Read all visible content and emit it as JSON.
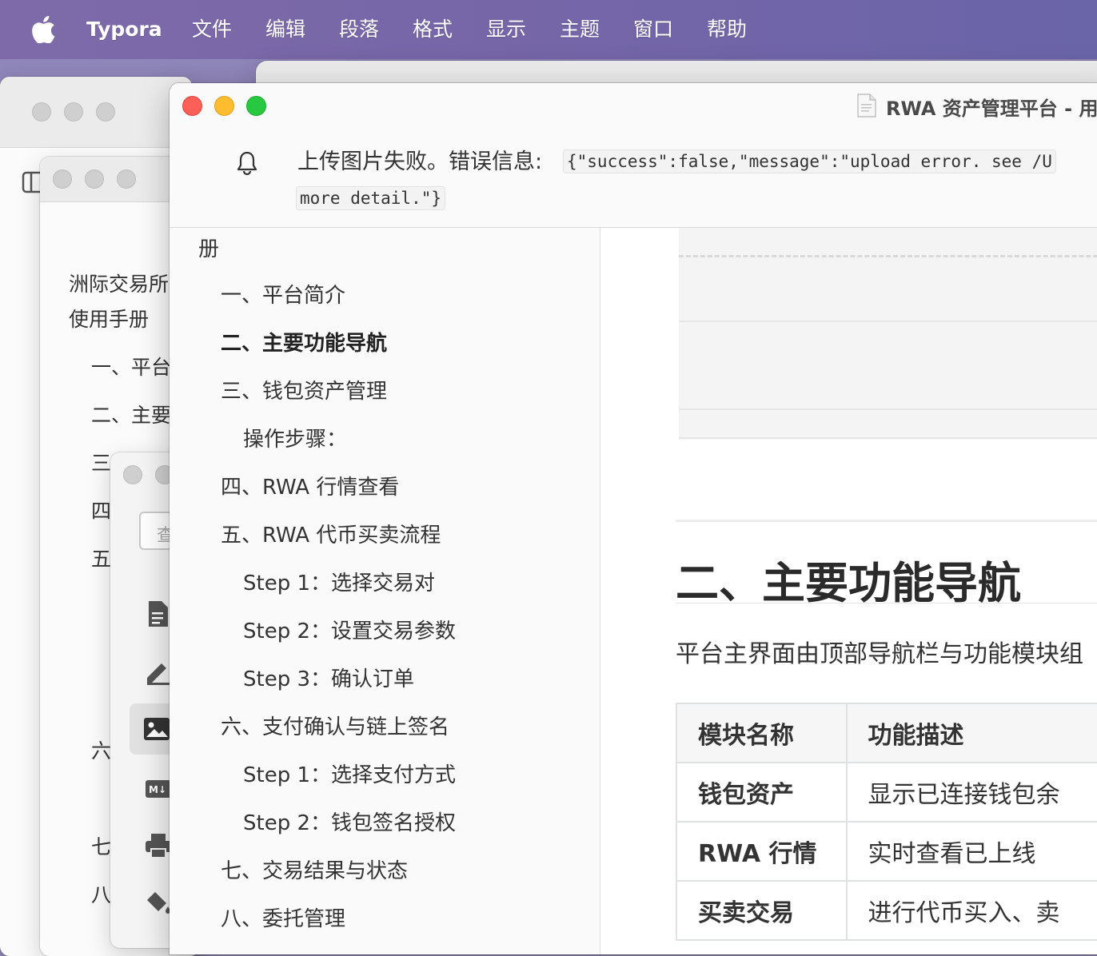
{
  "menubar": {
    "app": "Typora",
    "items": [
      "文件",
      "编辑",
      "段落",
      "格式",
      "显示",
      "主题",
      "窗口",
      "帮助"
    ]
  },
  "background_window": {
    "outline": [
      "洲际交易所",
      "使用手册",
      "一、平台",
      "二、主要",
      "三、",
      "四",
      "五",
      "六",
      "七",
      "八"
    ],
    "search_placeholder": "查"
  },
  "window": {
    "title": "RWA 资产管理平台 - 用",
    "notice_text": "上传图片失败。错误信息:",
    "notice_code_line1": "{\"success\":false,\"message\":\"upload error. see /U",
    "notice_code_line2": "more detail.\"}"
  },
  "outline": {
    "top_fragment": "册",
    "items": [
      {
        "label": "一、平台简介",
        "level": 1,
        "active": false
      },
      {
        "label": "二、主要功能导航",
        "level": 1,
        "active": true
      },
      {
        "label": "三、钱包资产管理",
        "level": 1,
        "active": false
      },
      {
        "label": "操作步骤：",
        "level": 2,
        "active": false
      },
      {
        "label": "四、RWA 行情查看",
        "level": 1,
        "active": false
      },
      {
        "label": "五、RWA 代币买卖流程",
        "level": 1,
        "active": false
      },
      {
        "label": "Step 1：选择交易对",
        "level": 2,
        "active": false
      },
      {
        "label": "Step 2：设置交易参数",
        "level": 2,
        "active": false
      },
      {
        "label": "Step 3：确认订单",
        "level": 2,
        "active": false
      },
      {
        "label": "六、支付确认与链上签名",
        "level": 1,
        "active": false
      },
      {
        "label": "Step 1：选择支付方式",
        "level": 2,
        "active": false
      },
      {
        "label": "Step 2：钱包签名授权",
        "level": 2,
        "active": false
      },
      {
        "label": "七、交易结果与状态",
        "level": 1,
        "active": false
      },
      {
        "label": "八、委托管理",
        "level": 1,
        "active": false
      }
    ]
  },
  "document": {
    "heading": "二、主要功能导航",
    "paragraph": "平台主界面由顶部导航栏与功能模块组",
    "table": {
      "headers": [
        "模块名称",
        "功能描述"
      ],
      "rows": [
        [
          "钱包资产",
          "显示已连接钱包余"
        ],
        [
          "RWA 行情",
          "实时查看已上线"
        ],
        [
          "买卖交易",
          "进行代币买入、卖"
        ]
      ]
    }
  },
  "colors": {
    "menubar": "#7566a8",
    "close": "#fe5f57",
    "minimize": "#febc2e",
    "zoom": "#28c840"
  }
}
